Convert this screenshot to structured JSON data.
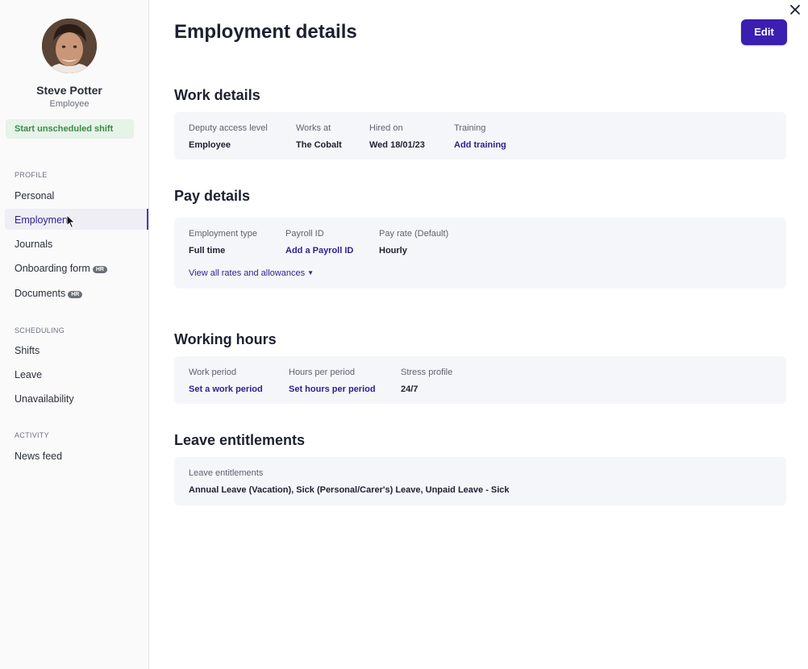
{
  "user": {
    "name": "Steve Potter",
    "role": "Employee"
  },
  "shift_button": "Start unscheduled shift",
  "sidebar": {
    "sections": [
      {
        "label": "PROFILE",
        "items": [
          {
            "label": "Personal"
          },
          {
            "label": "Employment",
            "active": true
          },
          {
            "label": "Journals"
          },
          {
            "label": "Onboarding form",
            "badge": "HR"
          },
          {
            "label": "Documents",
            "badge": "HR"
          }
        ]
      },
      {
        "label": "SCHEDULING",
        "items": [
          {
            "label": "Shifts"
          },
          {
            "label": "Leave"
          },
          {
            "label": "Unavailability"
          }
        ]
      },
      {
        "label": "ACTIVITY",
        "items": [
          {
            "label": "News feed"
          }
        ]
      }
    ]
  },
  "page": {
    "title": "Employment details",
    "edit_label": "Edit"
  },
  "work_details": {
    "title": "Work details",
    "fields": [
      {
        "label": "Deputy access level",
        "value": "Employee"
      },
      {
        "label": "Works at",
        "value": "The Cobalt"
      },
      {
        "label": "Hired on",
        "value": "Wed 18/01/23"
      },
      {
        "label": "Training",
        "value": "Add training",
        "link": true
      }
    ]
  },
  "pay_details": {
    "title": "Pay details",
    "fields": [
      {
        "label": "Employment type",
        "value": "Full time"
      },
      {
        "label": "Payroll ID",
        "value": "Add a Payroll ID",
        "link": true
      },
      {
        "label": "Pay rate (Default)",
        "value": "Hourly"
      }
    ],
    "view_all": "View all rates and allowances"
  },
  "working_hours": {
    "title": "Working hours",
    "fields": [
      {
        "label": "Work period",
        "value": "Set a work period",
        "link": true
      },
      {
        "label": "Hours per period",
        "value": "Set hours per period",
        "link": true
      },
      {
        "label": "Stress profile",
        "value": "24/7"
      }
    ]
  },
  "leave_entitlements": {
    "title": "Leave entitlements",
    "fields": [
      {
        "label": "Leave entitlements",
        "value": "Annual Leave (Vacation), Sick (Personal/Carer's) Leave, Unpaid Leave - Sick"
      }
    ]
  },
  "colors": {
    "accent": "#3a1fb0",
    "link": "#2e1f8f",
    "shift_bg": "#e6f3e8",
    "shift_text": "#3b8a48"
  }
}
